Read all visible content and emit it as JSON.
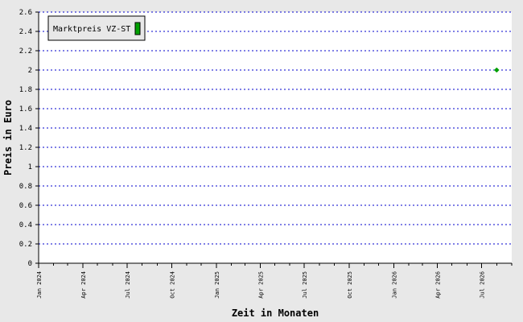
{
  "chart_data": {
    "type": "scatter",
    "title": "",
    "xlabel": "Zeit in Monaten",
    "ylabel": "Preis in Euro",
    "ylim": [
      0,
      2.6
    ],
    "y_ticks": [
      0,
      0.2,
      0.4,
      0.6,
      0.8,
      1,
      1.2,
      1.4,
      1.6,
      1.8,
      2,
      2.2,
      2.4,
      2.6
    ],
    "y_tick_labels": [
      "0",
      "0.2",
      "0.4",
      "0.6",
      "0.8",
      "1",
      "1.2",
      "1.4",
      "1.6",
      "1.8",
      "2",
      "2.2",
      "2.4",
      "2.6"
    ],
    "xlim": [
      "2024-01-01",
      "2026-09-01"
    ],
    "x_tick_labels": [
      {
        "date": "2024-01-01",
        "label": "Jan 2024"
      },
      {
        "date": "2024-04-01",
        "label": "Apr 2024"
      },
      {
        "date": "2024-07-01",
        "label": "Jul 2024"
      },
      {
        "date": "2024-10-01",
        "label": "Oct 2024"
      },
      {
        "date": "2025-01-01",
        "label": "Jan 2025"
      },
      {
        "date": "2025-04-01",
        "label": "Apr 2025"
      },
      {
        "date": "2025-07-01",
        "label": "Jul 2025"
      },
      {
        "date": "2025-10-01",
        "label": "Oct 2025"
      },
      {
        "date": "2026-01-01",
        "label": "Jan 2026"
      },
      {
        "date": "2026-04-01",
        "label": "Apr 2026"
      },
      {
        "date": "2026-07-01",
        "label": "Jul 2026"
      }
    ],
    "grid": true,
    "legend_position": "top-left",
    "series": [
      {
        "name": "Marktpreis VZ-ST",
        "color": "#00a000",
        "marker": "diamond",
        "points": [
          {
            "x": "2026-08-01",
            "y": 2
          }
        ]
      }
    ]
  },
  "colors": {
    "background": "#e8e8e8",
    "plot_background": "#ffffff",
    "grid": "#0000cc",
    "axis": "#000000"
  }
}
